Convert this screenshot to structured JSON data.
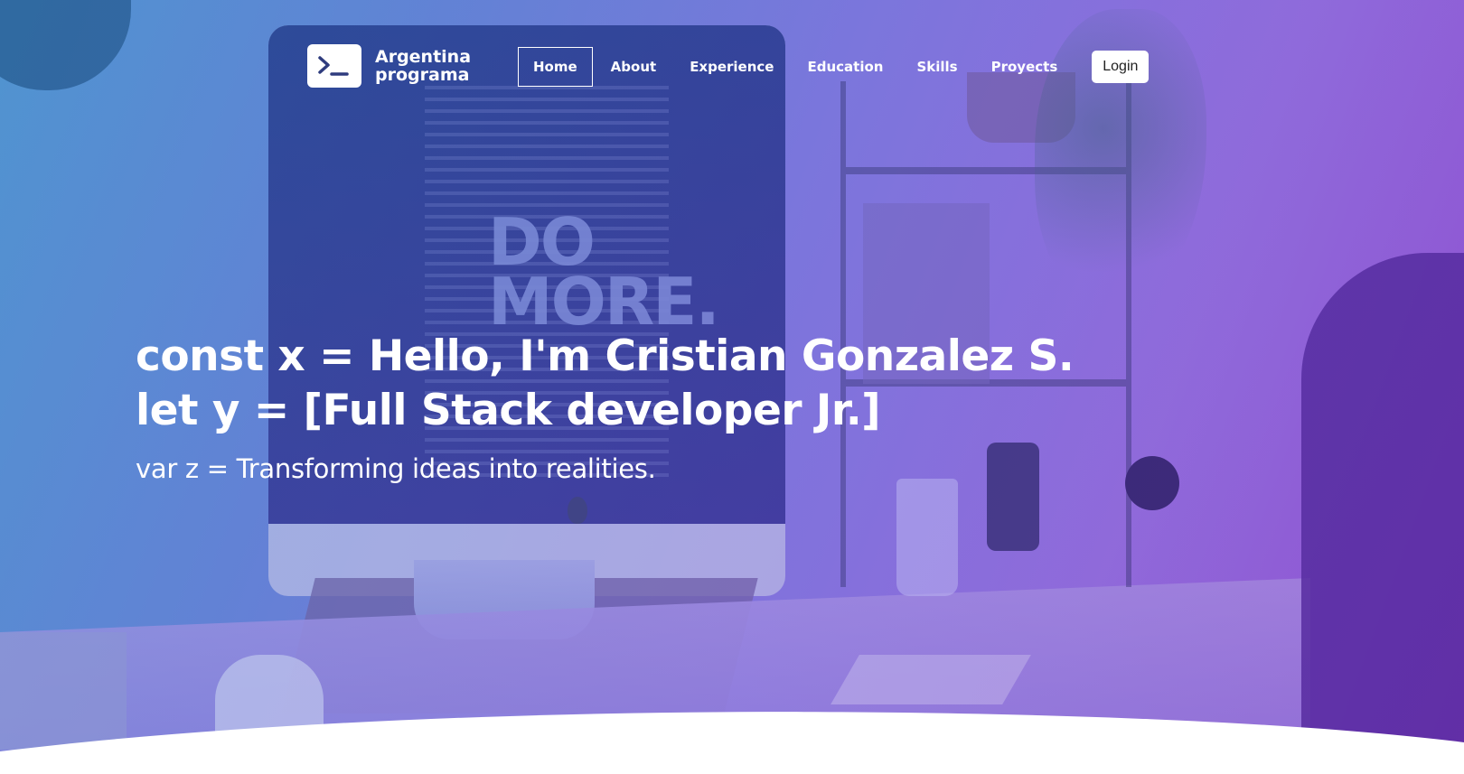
{
  "brand": {
    "line1": "Argentina",
    "line2": "programa",
    "logo_icon": "terminal-prompt-icon"
  },
  "nav": {
    "items": [
      {
        "label": "Home",
        "active": true
      },
      {
        "label": "About",
        "active": false
      },
      {
        "label": "Experience",
        "active": false
      },
      {
        "label": "Education",
        "active": false
      },
      {
        "label": "Skills",
        "active": false
      },
      {
        "label": "Proyects",
        "active": false
      }
    ],
    "login_label": "Login"
  },
  "hero": {
    "line1": "const x = Hello, I'm Cristian Gonzalez S.",
    "line2": "let y = [Full Stack developer Jr.]",
    "subtitle": "var z = Transforming ideas into realities.",
    "background_poster_text": "DO MORE."
  },
  "colors": {
    "gradient_start": "#5f9fd3",
    "gradient_end": "#9a5fd8",
    "text": "#ffffff",
    "login_bg": "#ffffff"
  }
}
